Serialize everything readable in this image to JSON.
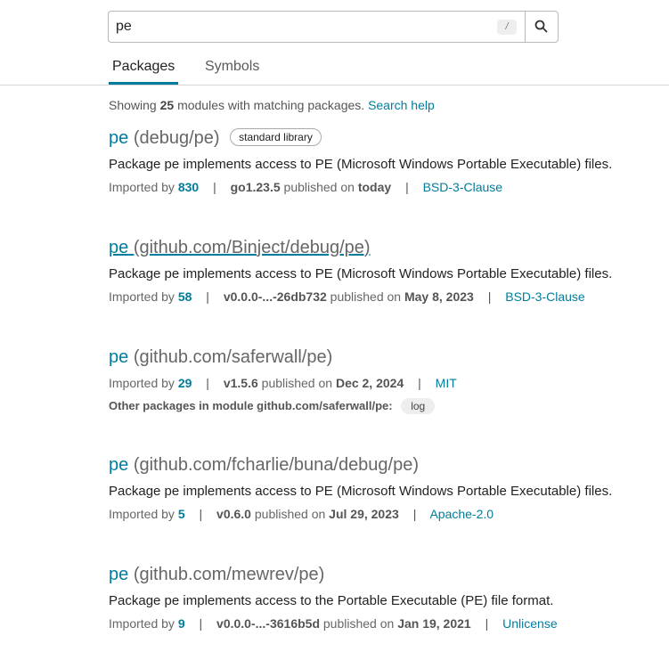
{
  "search": {
    "value": "pe",
    "shortcut": "/"
  },
  "tabs": [
    {
      "label": "Packages"
    },
    {
      "label": "Symbols"
    }
  ],
  "summary": {
    "prefix": "Showing",
    "count": "25",
    "suffix": "modules with matching packages.",
    "help": "Search help"
  },
  "labels": {
    "imported_by": "Imported by",
    "published_on": "published on",
    "sep": "|"
  },
  "results": [
    {
      "name": "pe",
      "path": "(debug/pe)",
      "badge": "standard library",
      "synopsis": "Package pe implements access to PE (Microsoft Windows Portable Executable) files.",
      "imported_by": "830",
      "version": "go1.23.5",
      "date": "today",
      "license": "BSD-3-Clause"
    },
    {
      "name": "pe",
      "path": "(github.com/Binject/debug/pe)",
      "synopsis": "Package pe implements access to PE (Microsoft Windows Portable Executable) files.",
      "imported_by": "58",
      "version": "v0.0.0-...-26db732",
      "date": "May 8, 2023",
      "license": "BSD-3-Clause"
    },
    {
      "name": "pe",
      "path": "(github.com/saferwall/pe)",
      "imported_by": "29",
      "version": "v1.5.6",
      "date": "Dec 2, 2024",
      "license": "MIT",
      "other_label": "Other packages in module github.com/saferwall/pe:",
      "other_chip": "log"
    },
    {
      "name": "pe",
      "path": "(github.com/fcharlie/buna/debug/pe)",
      "synopsis": "Package pe implements access to PE (Microsoft Windows Portable Executable) files.",
      "imported_by": "5",
      "version": "v0.6.0",
      "date": "Jul 29, 2023",
      "license": "Apache-2.0"
    },
    {
      "name": "pe",
      "path": "(github.com/mewrev/pe)",
      "synopsis": "Package pe implements access to the Portable Executable (PE) file format.",
      "imported_by": "9",
      "version": "v0.0.0-...-3616b5d",
      "date": "Jan 19, 2021",
      "license": "Unlicense"
    }
  ]
}
